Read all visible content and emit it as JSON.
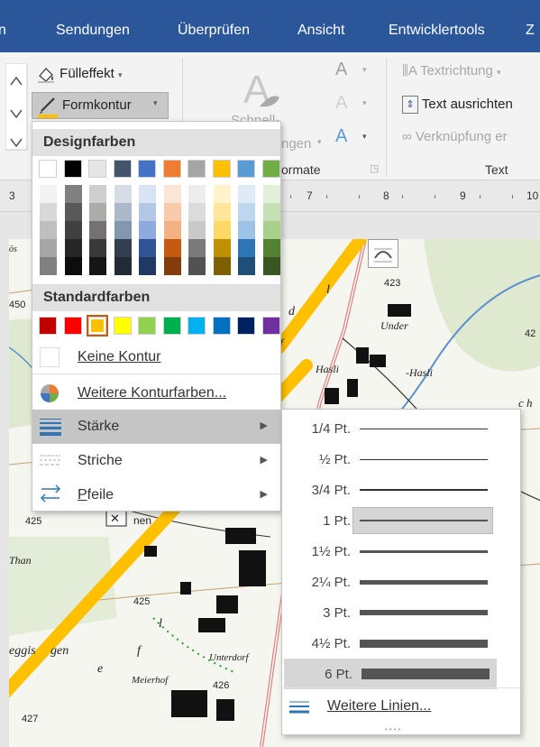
{
  "ribbon_tabs": [
    "n",
    "Sendungen",
    "Überprüfen",
    "Ansicht",
    "Entwicklertools",
    "Z"
  ],
  "ribbon": {
    "fill_effect": "Fülleffekt",
    "shape_outline": "Formkontur",
    "quick_styles_line1": "Schnell-",
    "quick_styles_line2": "ngen",
    "formats_label": "ormate",
    "text_direction": "Textrichtung",
    "align_text": "Text ausrichten",
    "create_link": "Verknüpfung er",
    "text_group_label": "Text"
  },
  "ruler": [
    "3",
    "7",
    "8",
    "9",
    "10"
  ],
  "map_labels": [
    "423",
    "Under",
    "Hasli",
    "-Hasli",
    "425",
    "Than",
    "425",
    "eggis",
    "gen",
    "Unterdorf",
    "Meierhof",
    "426",
    "427",
    "450",
    "42",
    "c h",
    "nen",
    "ös"
  ],
  "menu": {
    "design_colors_header": "Designfarben",
    "standard_colors_header": "Standardfarben",
    "no_outline": "Keine Kontur",
    "more_colors": "Weitere Konturfarben...",
    "weight": "Stärke",
    "dashes": "Striche",
    "arrows": "Pfeile"
  },
  "theme_colors_top": [
    "#ffffff",
    "#000000",
    "#e7e6e6",
    "#44546a",
    "#4472c4",
    "#ed7d31",
    "#a5a5a5",
    "#ffc000",
    "#5b9bd5",
    "#70ad47"
  ],
  "theme_shades": [
    [
      "#f2f2f2",
      "#d9d9d9",
      "#bfbfbf",
      "#a6a6a6",
      "#808080"
    ],
    [
      "#808080",
      "#595959",
      "#404040",
      "#262626",
      "#0d0d0d"
    ],
    [
      "#d0cece",
      "#aeabab",
      "#757171",
      "#3a3838",
      "#171616"
    ],
    [
      "#d6dce5",
      "#adb9ca",
      "#8497b0",
      "#333f50",
      "#222a35"
    ],
    [
      "#dae3f3",
      "#b4c7e7",
      "#8faadc",
      "#2f5597",
      "#1f3864"
    ],
    [
      "#fbe5d6",
      "#f8cbad",
      "#f4b183",
      "#c55a11",
      "#843c0c"
    ],
    [
      "#ededed",
      "#dbdbdb",
      "#c9c9c9",
      "#7b7b7b",
      "#525252"
    ],
    [
      "#fff2cc",
      "#ffe699",
      "#ffd966",
      "#bf9000",
      "#7f6000"
    ],
    [
      "#deebf7",
      "#bdd7ee",
      "#9dc3e6",
      "#2e75b6",
      "#1f4e79"
    ],
    [
      "#e2f0d9",
      "#c5e0b4",
      "#a9d18e",
      "#548235",
      "#385723"
    ]
  ],
  "standard_colors": [
    "#c00000",
    "#ff0000",
    "#ffc000",
    "#ffff00",
    "#92d050",
    "#00b050",
    "#00b0f0",
    "#0070c0",
    "#002060",
    "#7030a0"
  ],
  "selected_standard_color": "#ffc000",
  "weights": [
    {
      "label": "1/4 Pt.",
      "pt": 0.25
    },
    {
      "label": "½ Pt.",
      "pt": 0.5
    },
    {
      "label": "3/4 Pt.",
      "pt": 0.75
    },
    {
      "label": "1 Pt.",
      "pt": 1
    },
    {
      "label": "1½ Pt.",
      "pt": 1.5
    },
    {
      "label": "2¼ Pt.",
      "pt": 2.25
    },
    {
      "label": "3 Pt.",
      "pt": 3
    },
    {
      "label": "4½ Pt.",
      "pt": 4.5
    },
    {
      "label": "6 Pt.",
      "pt": 6
    }
  ],
  "highlighted_weight": "1 Pt.",
  "hovered_weight": "6 Pt.",
  "more_lines": "Weitere Linien..."
}
